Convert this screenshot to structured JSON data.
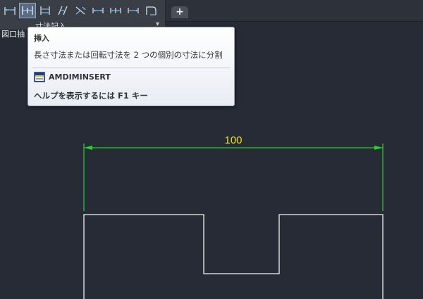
{
  "colors": {
    "canvas_bg": "#262b36",
    "dimension": "#28d22a",
    "dimension_text": "#e9e21a",
    "geometry": "#f2f2f2"
  },
  "ribbon": {
    "tools": [
      {
        "name": "linear-dimension-icon"
      },
      {
        "name": "insert-dimension-icon",
        "active": true
      },
      {
        "name": "baseline-dimension-icon"
      },
      {
        "name": "aligned-dimension-icon"
      },
      {
        "name": "break-dimension-icon"
      },
      {
        "name": "continue-dimension-icon"
      },
      {
        "name": "ordinate-dimension-icon"
      },
      {
        "name": "chain-dimension-icon"
      },
      {
        "name": "arc-dimension-icon"
      }
    ],
    "panel_label": "寸法記入",
    "panel_arrow": "▾"
  },
  "drawing_label": "図口抽",
  "tabs": {
    "new_tab": "+"
  },
  "tooltip": {
    "title": "挿入",
    "description": "長さ寸法または回転寸法を 2 つの個別の寸法に分割",
    "command": "AMDIMINSERT",
    "help": "ヘルプを表示するには F1 キー"
  },
  "drawing": {
    "dimension_value": "100"
  }
}
